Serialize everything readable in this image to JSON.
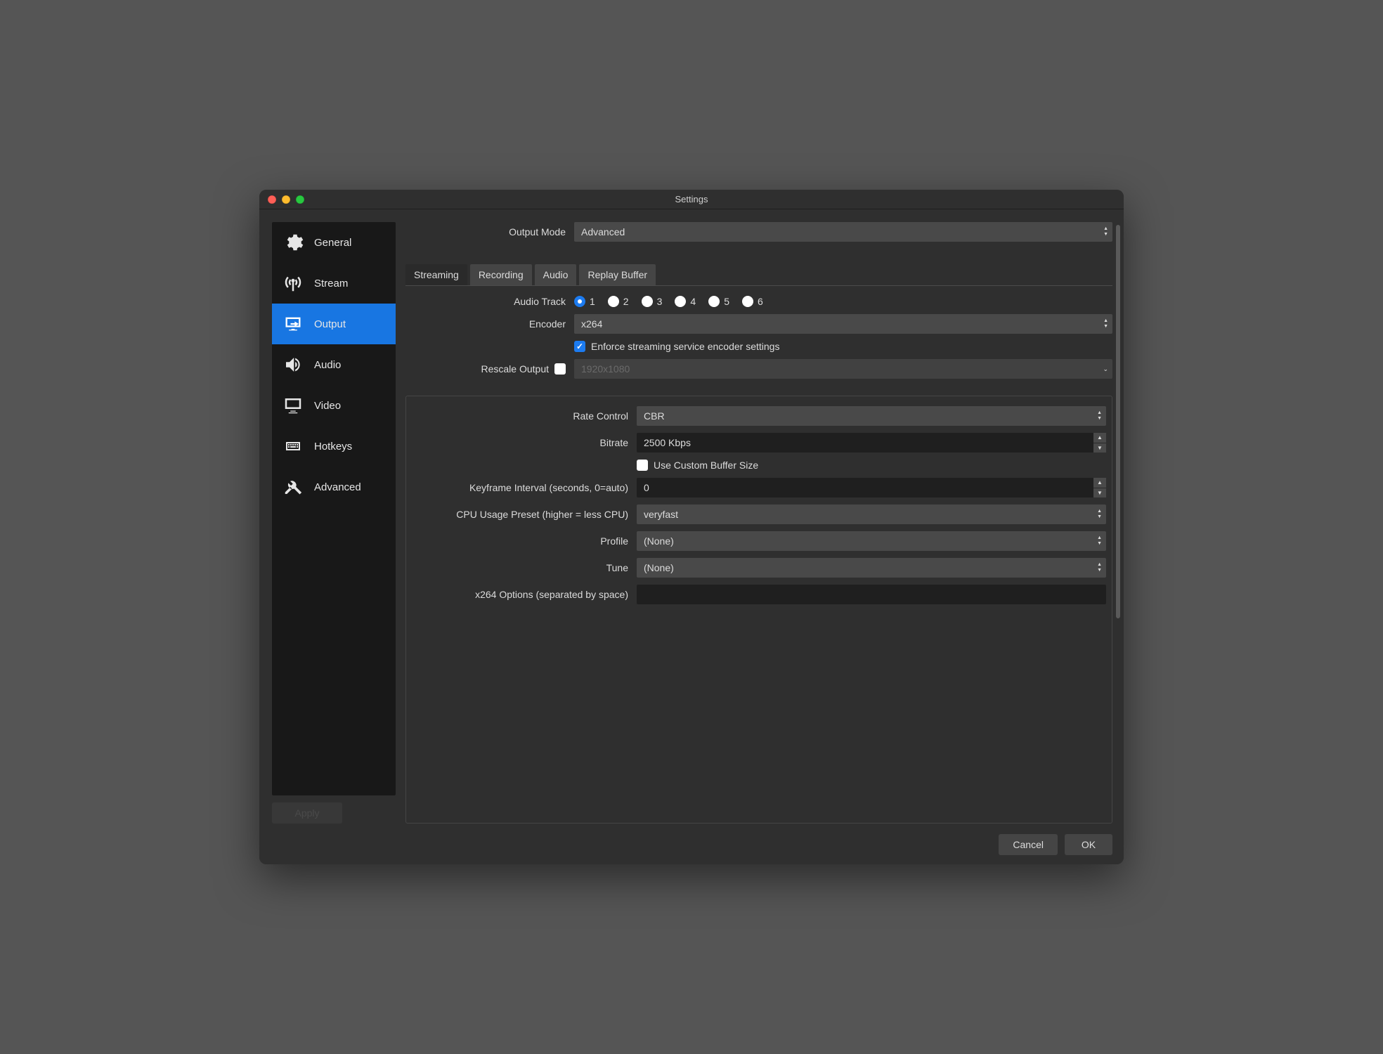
{
  "window": {
    "title": "Settings"
  },
  "sidebar": {
    "items": [
      {
        "label": "General",
        "icon": "gear-icon"
      },
      {
        "label": "Stream",
        "icon": "antenna-icon"
      },
      {
        "label": "Output",
        "icon": "display-arrow-icon",
        "selected": true
      },
      {
        "label": "Audio",
        "icon": "speaker-icon"
      },
      {
        "label": "Video",
        "icon": "monitor-icon"
      },
      {
        "label": "Hotkeys",
        "icon": "keyboard-icon"
      },
      {
        "label": "Advanced",
        "icon": "tools-icon"
      }
    ]
  },
  "footer": {
    "apply": "Apply",
    "cancel": "Cancel",
    "ok": "OK"
  },
  "main": {
    "output_mode_label": "Output Mode",
    "output_mode_value": "Advanced",
    "tabs": [
      {
        "label": "Streaming",
        "active": true
      },
      {
        "label": "Recording"
      },
      {
        "label": "Audio"
      },
      {
        "label": "Replay Buffer"
      }
    ],
    "audio_track_label": "Audio Track",
    "audio_track_options": [
      "1",
      "2",
      "3",
      "4",
      "5",
      "6"
    ],
    "audio_track_selected": "1",
    "encoder_label": "Encoder",
    "encoder_value": "x264",
    "enforce_label": "Enforce streaming service encoder settings",
    "enforce_checked": true,
    "rescale_label": "Rescale Output",
    "rescale_checked": false,
    "rescale_value": "1920x1080",
    "encoder_box": {
      "rate_control_label": "Rate Control",
      "rate_control_value": "CBR",
      "bitrate_label": "Bitrate",
      "bitrate_value": "2500 Kbps",
      "custom_buffer_label": "Use Custom Buffer Size",
      "custom_buffer_checked": false,
      "keyframe_label": "Keyframe Interval (seconds, 0=auto)",
      "keyframe_value": "0",
      "preset_label": "CPU Usage Preset (higher = less CPU)",
      "preset_value": "veryfast",
      "profile_label": "Profile",
      "profile_value": "(None)",
      "tune_label": "Tune",
      "tune_value": "(None)",
      "x264opts_label": "x264 Options (separated by space)",
      "x264opts_value": ""
    }
  }
}
